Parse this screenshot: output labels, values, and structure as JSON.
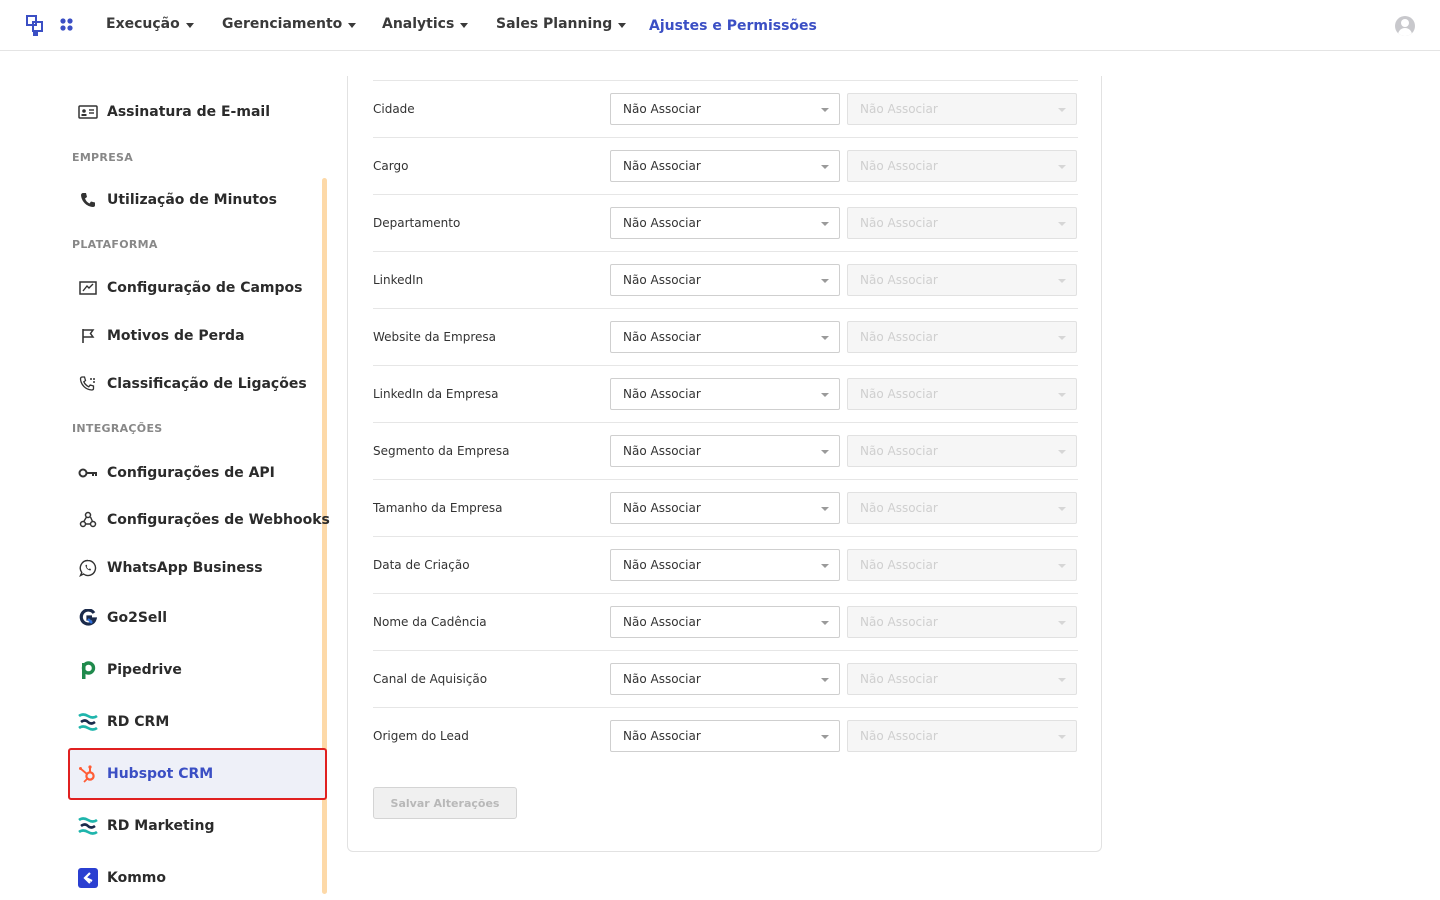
{
  "nav": {
    "items": [
      {
        "label": "Execução"
      },
      {
        "label": "Gerenciamento"
      },
      {
        "label": "Analytics"
      },
      {
        "label": "Sales Planning"
      }
    ],
    "active_label": "Ajustes e Permissões"
  },
  "sidebar": {
    "items": [
      {
        "label": "Assinatura de E-mail",
        "icon": "email-signature-icon"
      },
      {
        "label": "Utilização de Minutos",
        "icon": "phone-icon"
      },
      {
        "label": "Configuração de Campos",
        "icon": "fields-config-icon"
      },
      {
        "label": "Motivos de Perda",
        "icon": "flag-icon"
      },
      {
        "label": "Classificação de Ligações",
        "icon": "phone-rating-icon"
      },
      {
        "label": "Configurações de API",
        "icon": "key-icon"
      },
      {
        "label": "Configurações de Webhooks",
        "icon": "webhook-icon"
      },
      {
        "label": "WhatsApp Business",
        "icon": "whatsapp-icon"
      },
      {
        "label": "Go2Sell",
        "icon": "go2sell-logo-icon"
      },
      {
        "label": "Pipedrive",
        "icon": "pipedrive-logo-icon"
      },
      {
        "label": "RD CRM",
        "icon": "rd-crm-logo-icon"
      },
      {
        "label": "Hubspot CRM",
        "icon": "hubspot-logo-icon"
      },
      {
        "label": "RD Marketing",
        "icon": "rd-marketing-logo-icon"
      },
      {
        "label": "Kommo",
        "icon": "kommo-logo-icon"
      }
    ],
    "sections": {
      "empresa": "EMPRESA",
      "plataforma": "PLATAFORMA",
      "integracoes": "INTEGRAÇÕES"
    },
    "selected": "Hubspot CRM"
  },
  "fields": {
    "rows": [
      {
        "label": "Cidade",
        "value": "Não Associar",
        "secondary": "Não Associar"
      },
      {
        "label": "Cargo",
        "value": "Não Associar",
        "secondary": "Não Associar"
      },
      {
        "label": "Departamento",
        "value": "Não Associar",
        "secondary": "Não Associar"
      },
      {
        "label": "LinkedIn",
        "value": "Não Associar",
        "secondary": "Não Associar"
      },
      {
        "label": "Website da Empresa",
        "value": "Não Associar",
        "secondary": "Não Associar"
      },
      {
        "label": "LinkedIn da Empresa",
        "value": "Não Associar",
        "secondary": "Não Associar"
      },
      {
        "label": "Segmento da Empresa",
        "value": "Não Associar",
        "secondary": "Não Associar"
      },
      {
        "label": "Tamanho da Empresa",
        "value": "Não Associar",
        "secondary": "Não Associar"
      },
      {
        "label": "Data de Criação",
        "value": "Não Associar",
        "secondary": "Não Associar"
      },
      {
        "label": "Nome da Cadência",
        "value": "Não Associar",
        "secondary": "Não Associar"
      },
      {
        "label": "Canal de Aquisição",
        "value": "Não Associar",
        "secondary": "Não Associar"
      },
      {
        "label": "Origem do Lead",
        "value": "Não Associar",
        "secondary": "Não Associar"
      }
    ],
    "save_label": "Salvar Alterações"
  },
  "colors": {
    "accent": "#3b4fc4",
    "selection_border": "#e02020",
    "scrollbar": "#fdd9a8"
  }
}
